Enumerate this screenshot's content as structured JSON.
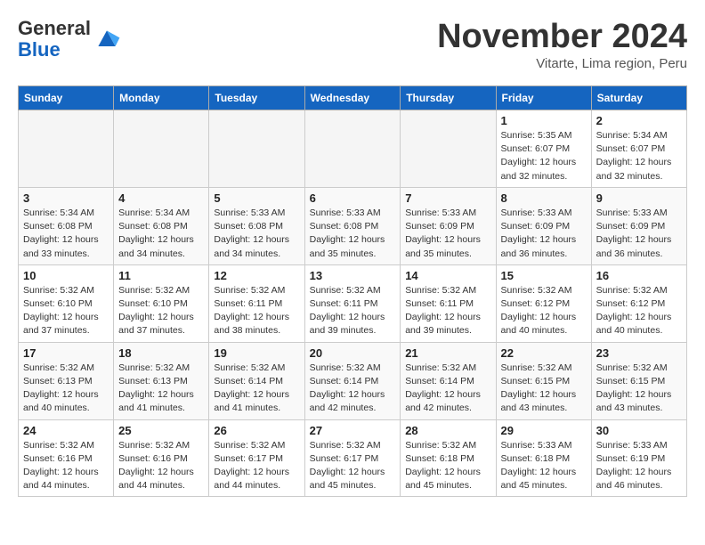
{
  "logo": {
    "general": "General",
    "blue": "Blue"
  },
  "header": {
    "month": "November 2024",
    "location": "Vitarte, Lima region, Peru"
  },
  "weekdays": [
    "Sunday",
    "Monday",
    "Tuesday",
    "Wednesday",
    "Thursday",
    "Friday",
    "Saturday"
  ],
  "weeks": [
    [
      {
        "day": "",
        "info": ""
      },
      {
        "day": "",
        "info": ""
      },
      {
        "day": "",
        "info": ""
      },
      {
        "day": "",
        "info": ""
      },
      {
        "day": "",
        "info": ""
      },
      {
        "day": "1",
        "info": "Sunrise: 5:35 AM\nSunset: 6:07 PM\nDaylight: 12 hours and 32 minutes."
      },
      {
        "day": "2",
        "info": "Sunrise: 5:34 AM\nSunset: 6:07 PM\nDaylight: 12 hours and 32 minutes."
      }
    ],
    [
      {
        "day": "3",
        "info": "Sunrise: 5:34 AM\nSunset: 6:08 PM\nDaylight: 12 hours and 33 minutes."
      },
      {
        "day": "4",
        "info": "Sunrise: 5:34 AM\nSunset: 6:08 PM\nDaylight: 12 hours and 34 minutes."
      },
      {
        "day": "5",
        "info": "Sunrise: 5:33 AM\nSunset: 6:08 PM\nDaylight: 12 hours and 34 minutes."
      },
      {
        "day": "6",
        "info": "Sunrise: 5:33 AM\nSunset: 6:08 PM\nDaylight: 12 hours and 35 minutes."
      },
      {
        "day": "7",
        "info": "Sunrise: 5:33 AM\nSunset: 6:09 PM\nDaylight: 12 hours and 35 minutes."
      },
      {
        "day": "8",
        "info": "Sunrise: 5:33 AM\nSunset: 6:09 PM\nDaylight: 12 hours and 36 minutes."
      },
      {
        "day": "9",
        "info": "Sunrise: 5:33 AM\nSunset: 6:09 PM\nDaylight: 12 hours and 36 minutes."
      }
    ],
    [
      {
        "day": "10",
        "info": "Sunrise: 5:32 AM\nSunset: 6:10 PM\nDaylight: 12 hours and 37 minutes."
      },
      {
        "day": "11",
        "info": "Sunrise: 5:32 AM\nSunset: 6:10 PM\nDaylight: 12 hours and 37 minutes."
      },
      {
        "day": "12",
        "info": "Sunrise: 5:32 AM\nSunset: 6:11 PM\nDaylight: 12 hours and 38 minutes."
      },
      {
        "day": "13",
        "info": "Sunrise: 5:32 AM\nSunset: 6:11 PM\nDaylight: 12 hours and 39 minutes."
      },
      {
        "day": "14",
        "info": "Sunrise: 5:32 AM\nSunset: 6:11 PM\nDaylight: 12 hours and 39 minutes."
      },
      {
        "day": "15",
        "info": "Sunrise: 5:32 AM\nSunset: 6:12 PM\nDaylight: 12 hours and 40 minutes."
      },
      {
        "day": "16",
        "info": "Sunrise: 5:32 AM\nSunset: 6:12 PM\nDaylight: 12 hours and 40 minutes."
      }
    ],
    [
      {
        "day": "17",
        "info": "Sunrise: 5:32 AM\nSunset: 6:13 PM\nDaylight: 12 hours and 40 minutes."
      },
      {
        "day": "18",
        "info": "Sunrise: 5:32 AM\nSunset: 6:13 PM\nDaylight: 12 hours and 41 minutes."
      },
      {
        "day": "19",
        "info": "Sunrise: 5:32 AM\nSunset: 6:14 PM\nDaylight: 12 hours and 41 minutes."
      },
      {
        "day": "20",
        "info": "Sunrise: 5:32 AM\nSunset: 6:14 PM\nDaylight: 12 hours and 42 minutes."
      },
      {
        "day": "21",
        "info": "Sunrise: 5:32 AM\nSunset: 6:14 PM\nDaylight: 12 hours and 42 minutes."
      },
      {
        "day": "22",
        "info": "Sunrise: 5:32 AM\nSunset: 6:15 PM\nDaylight: 12 hours and 43 minutes."
      },
      {
        "day": "23",
        "info": "Sunrise: 5:32 AM\nSunset: 6:15 PM\nDaylight: 12 hours and 43 minutes."
      }
    ],
    [
      {
        "day": "24",
        "info": "Sunrise: 5:32 AM\nSunset: 6:16 PM\nDaylight: 12 hours and 44 minutes."
      },
      {
        "day": "25",
        "info": "Sunrise: 5:32 AM\nSunset: 6:16 PM\nDaylight: 12 hours and 44 minutes."
      },
      {
        "day": "26",
        "info": "Sunrise: 5:32 AM\nSunset: 6:17 PM\nDaylight: 12 hours and 44 minutes."
      },
      {
        "day": "27",
        "info": "Sunrise: 5:32 AM\nSunset: 6:17 PM\nDaylight: 12 hours and 45 minutes."
      },
      {
        "day": "28",
        "info": "Sunrise: 5:32 AM\nSunset: 6:18 PM\nDaylight: 12 hours and 45 minutes."
      },
      {
        "day": "29",
        "info": "Sunrise: 5:33 AM\nSunset: 6:18 PM\nDaylight: 12 hours and 45 minutes."
      },
      {
        "day": "30",
        "info": "Sunrise: 5:33 AM\nSunset: 6:19 PM\nDaylight: 12 hours and 46 minutes."
      }
    ]
  ]
}
